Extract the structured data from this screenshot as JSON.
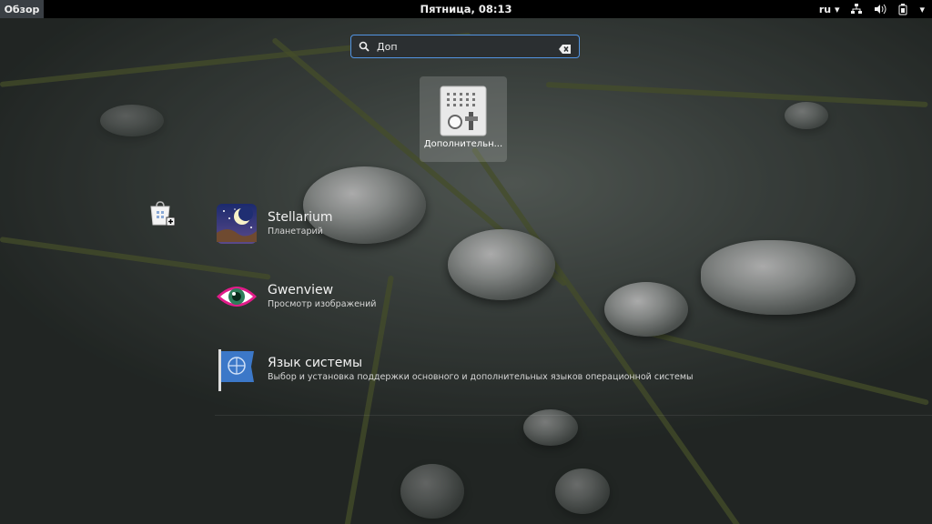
{
  "topbar": {
    "activities_label": "Обзор",
    "clock": "Пятница, 08:13",
    "language": "ru",
    "icons": [
      "network-icon",
      "volume-icon",
      "battery-icon",
      "chevron-down-icon"
    ]
  },
  "search": {
    "value": "Доп",
    "icon": "search-icon",
    "clear_icon": "clear-icon"
  },
  "app_results": [
    {
      "label": "Дополнительн...",
      "icon": "settings-tweaks-icon"
    }
  ],
  "provider": {
    "icon": "software-center-icon"
  },
  "search_results": [
    {
      "title": "Stellarium",
      "description": "Планетарий",
      "icon": "stellarium-icon"
    },
    {
      "title": "Gwenview",
      "description": "Просмотр изображений",
      "icon": "gwenview-icon"
    },
    {
      "title": "Язык системы",
      "description": "Выбор и установка поддержки основного и дополнительных языков операционной системы",
      "icon": "language-flag-icon"
    }
  ],
  "colors": {
    "accent": "#5294e2",
    "topbar_bg": "#000000",
    "activities_bg": "#3a3f44"
  }
}
